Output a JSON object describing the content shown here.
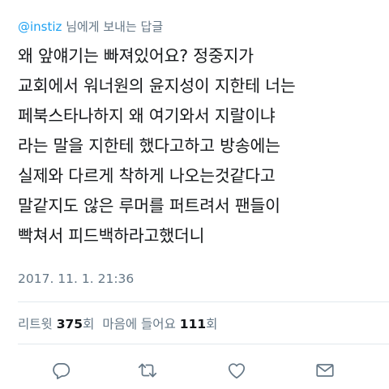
{
  "reply": {
    "handle": "@instiz",
    "suffix": " 님에게 보내는 답글"
  },
  "tweet": {
    "lines": [
      "왜 앞얘기는 빠져있어요? 정중지가",
      "교회에서 워너원의 윤지성이 지한테 너는",
      "페북스타나하지 왜 여기와서 지랄이냐",
      "라는 말을 지한테 했다고하고 방송에는",
      "실제와 다르게 착하게 나오는것같다고",
      "말같지도 않은 루머를 퍼트려서 팬들이",
      "빡쳐서 피드백하라고했더니"
    ],
    "timestamp": "2017. 11. 1. 21:36"
  },
  "stats": {
    "retweet_label": "리트윗",
    "retweet_count": "375",
    "retweet_unit": "회",
    "like_label": "마음에 들어요",
    "like_count": "111",
    "like_unit": "회"
  },
  "actions": {
    "icons": [
      "reply-icon",
      "retweet-icon",
      "like-icon",
      "message-icon"
    ]
  },
  "colors": {
    "accent": "#1da1f2",
    "secondary_text": "#657786",
    "icon": "#657786",
    "divider": "#e1e8ed"
  }
}
